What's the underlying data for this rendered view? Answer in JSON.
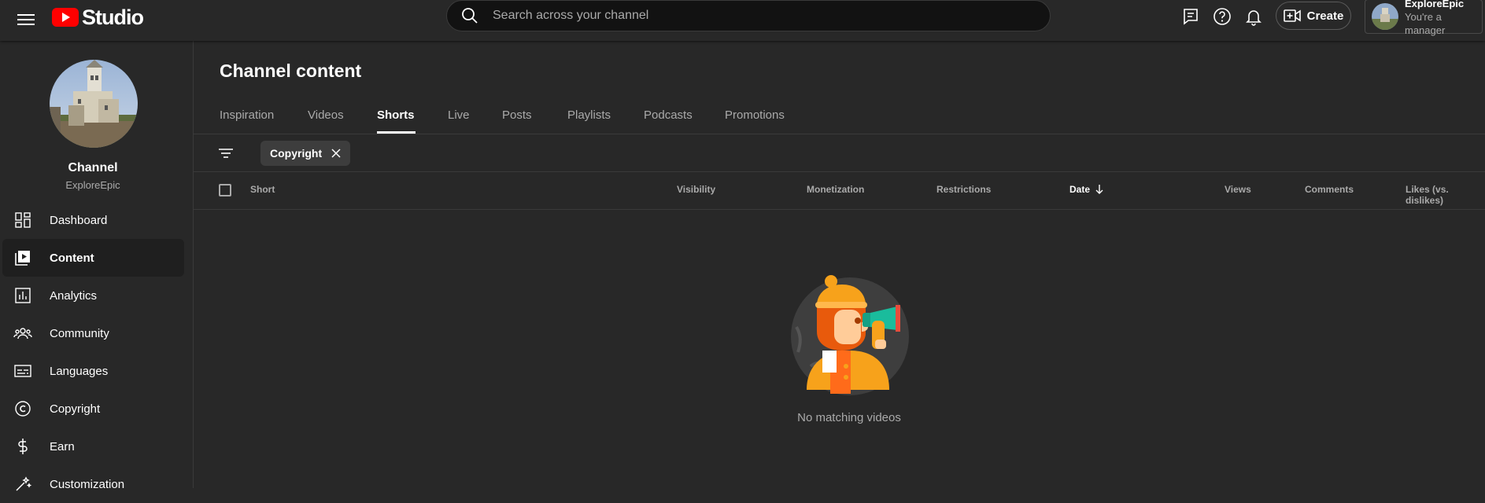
{
  "header": {
    "logo_text": "Studio",
    "search_placeholder": "Search across your channel",
    "create_label": "Create",
    "account": {
      "name": "ExploreEpic",
      "role": "You're a manager"
    }
  },
  "sidebar": {
    "channel_title": "Channel",
    "channel_handle": "ExploreEpic",
    "items": [
      {
        "label": "Dashboard",
        "icon": "dashboard-icon"
      },
      {
        "label": "Content",
        "icon": "content-icon",
        "active": true
      },
      {
        "label": "Analytics",
        "icon": "analytics-icon"
      },
      {
        "label": "Community",
        "icon": "community-icon"
      },
      {
        "label": "Languages",
        "icon": "languages-icon"
      },
      {
        "label": "Copyright",
        "icon": "copyright-icon"
      },
      {
        "label": "Earn",
        "icon": "earn-icon"
      },
      {
        "label": "Customization",
        "icon": "customization-icon"
      }
    ]
  },
  "main": {
    "title": "Channel content",
    "tabs": [
      {
        "label": "Inspiration"
      },
      {
        "label": "Videos"
      },
      {
        "label": "Shorts",
        "active": true
      },
      {
        "label": "Live"
      },
      {
        "label": "Posts"
      },
      {
        "label": "Playlists"
      },
      {
        "label": "Podcasts"
      },
      {
        "label": "Promotions"
      }
    ],
    "filter_chip": "Copyright",
    "columns": [
      "Short",
      "Visibility",
      "Monetization",
      "Restrictions",
      "Date",
      "Views",
      "Comments",
      "Likes (vs. dislikes)"
    ],
    "sorted_column": "Date",
    "empty_message": "No matching videos"
  },
  "colors": {
    "background": "#282828",
    "brand_red": "#ff0000",
    "active_tab": "#ffffff",
    "muted_text": "#aaaaaa"
  }
}
